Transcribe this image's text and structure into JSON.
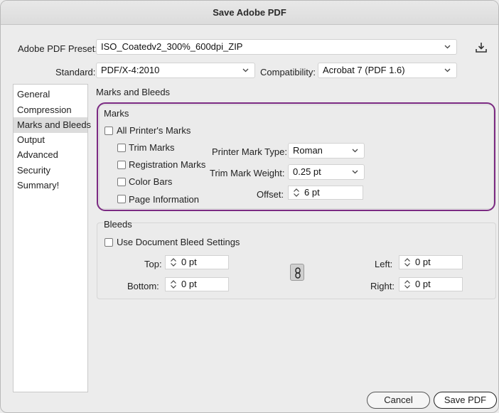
{
  "window": {
    "title": "Save Adobe PDF"
  },
  "preset": {
    "label": "Adobe PDF Preset:",
    "value": "ISO_Coatedv2_300%_600dpi_ZIP"
  },
  "standard": {
    "label": "Standard:",
    "value": "PDF/X-4:2010"
  },
  "compatibility": {
    "label": "Compatibility:",
    "value": "Acrobat 7 (PDF 1.6)"
  },
  "sidebar": {
    "items": [
      {
        "label": "General"
      },
      {
        "label": "Compression"
      },
      {
        "label": "Marks and Bleeds",
        "selected": true
      },
      {
        "label": "Output"
      },
      {
        "label": "Advanced"
      },
      {
        "label": "Security"
      },
      {
        "label": "Summary!"
      }
    ]
  },
  "section_title": "Marks and Bleeds",
  "marks": {
    "title": "Marks",
    "all_printers_marks": {
      "label": "All Printer's Marks",
      "checked": false
    },
    "trim_marks": {
      "label": "Trim Marks",
      "checked": false
    },
    "registration_marks": {
      "label": "Registration Marks",
      "checked": false
    },
    "color_bars": {
      "label": "Color Bars",
      "checked": false
    },
    "page_information": {
      "label": "Page Information",
      "checked": false
    },
    "printer_mark_type": {
      "label": "Printer Mark Type:",
      "value": "Roman"
    },
    "trim_mark_weight": {
      "label": "Trim Mark Weight:",
      "value": "0.25 pt"
    },
    "offset": {
      "label": "Offset:",
      "value": "6 pt"
    }
  },
  "bleeds": {
    "title": "Bleeds",
    "use_document": {
      "label": "Use Document Bleed Settings",
      "checked": false
    },
    "top": {
      "label": "Top:",
      "value": "0 pt"
    },
    "bottom": {
      "label": "Bottom:",
      "value": "0 pt"
    },
    "left": {
      "label": "Left:",
      "value": "0 pt"
    },
    "right": {
      "label": "Right:",
      "value": "0 pt"
    }
  },
  "buttons": {
    "cancel": "Cancel",
    "save": "Save PDF"
  },
  "colors": {
    "highlight": "#7b2a82",
    "selected_row": "#dcdcdc"
  },
  "icons": {
    "save_preset": "download-tray-icon",
    "link": "chain-link-icon",
    "dropdown": "chevron-down-icon",
    "spinner": "stepper-icon"
  }
}
